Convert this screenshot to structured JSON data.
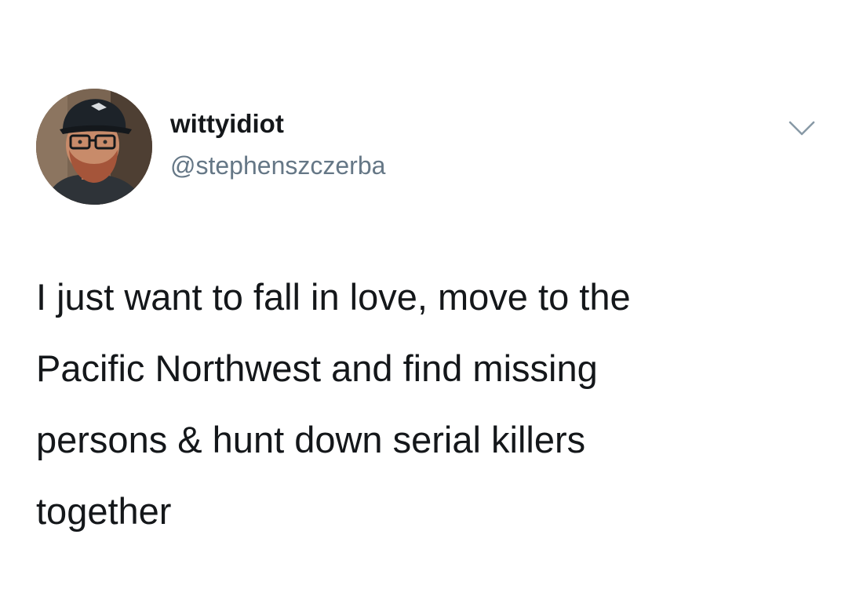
{
  "tweet": {
    "author": {
      "display_name": "wittyidiot",
      "handle": "@stephenszczerba",
      "avatar_icon": "profile-photo"
    },
    "menu_icon": "chevron-down-icon",
    "text_lines": [
      "I just want to fall in love, move to the",
      "Pacific Northwest and find missing",
      "persons & hunt down serial killers",
      "together"
    ]
  },
  "colors": {
    "background": "#ffffff",
    "text": "#14171a",
    "secondary_text": "#657786",
    "chevron": "#8899a6"
  }
}
